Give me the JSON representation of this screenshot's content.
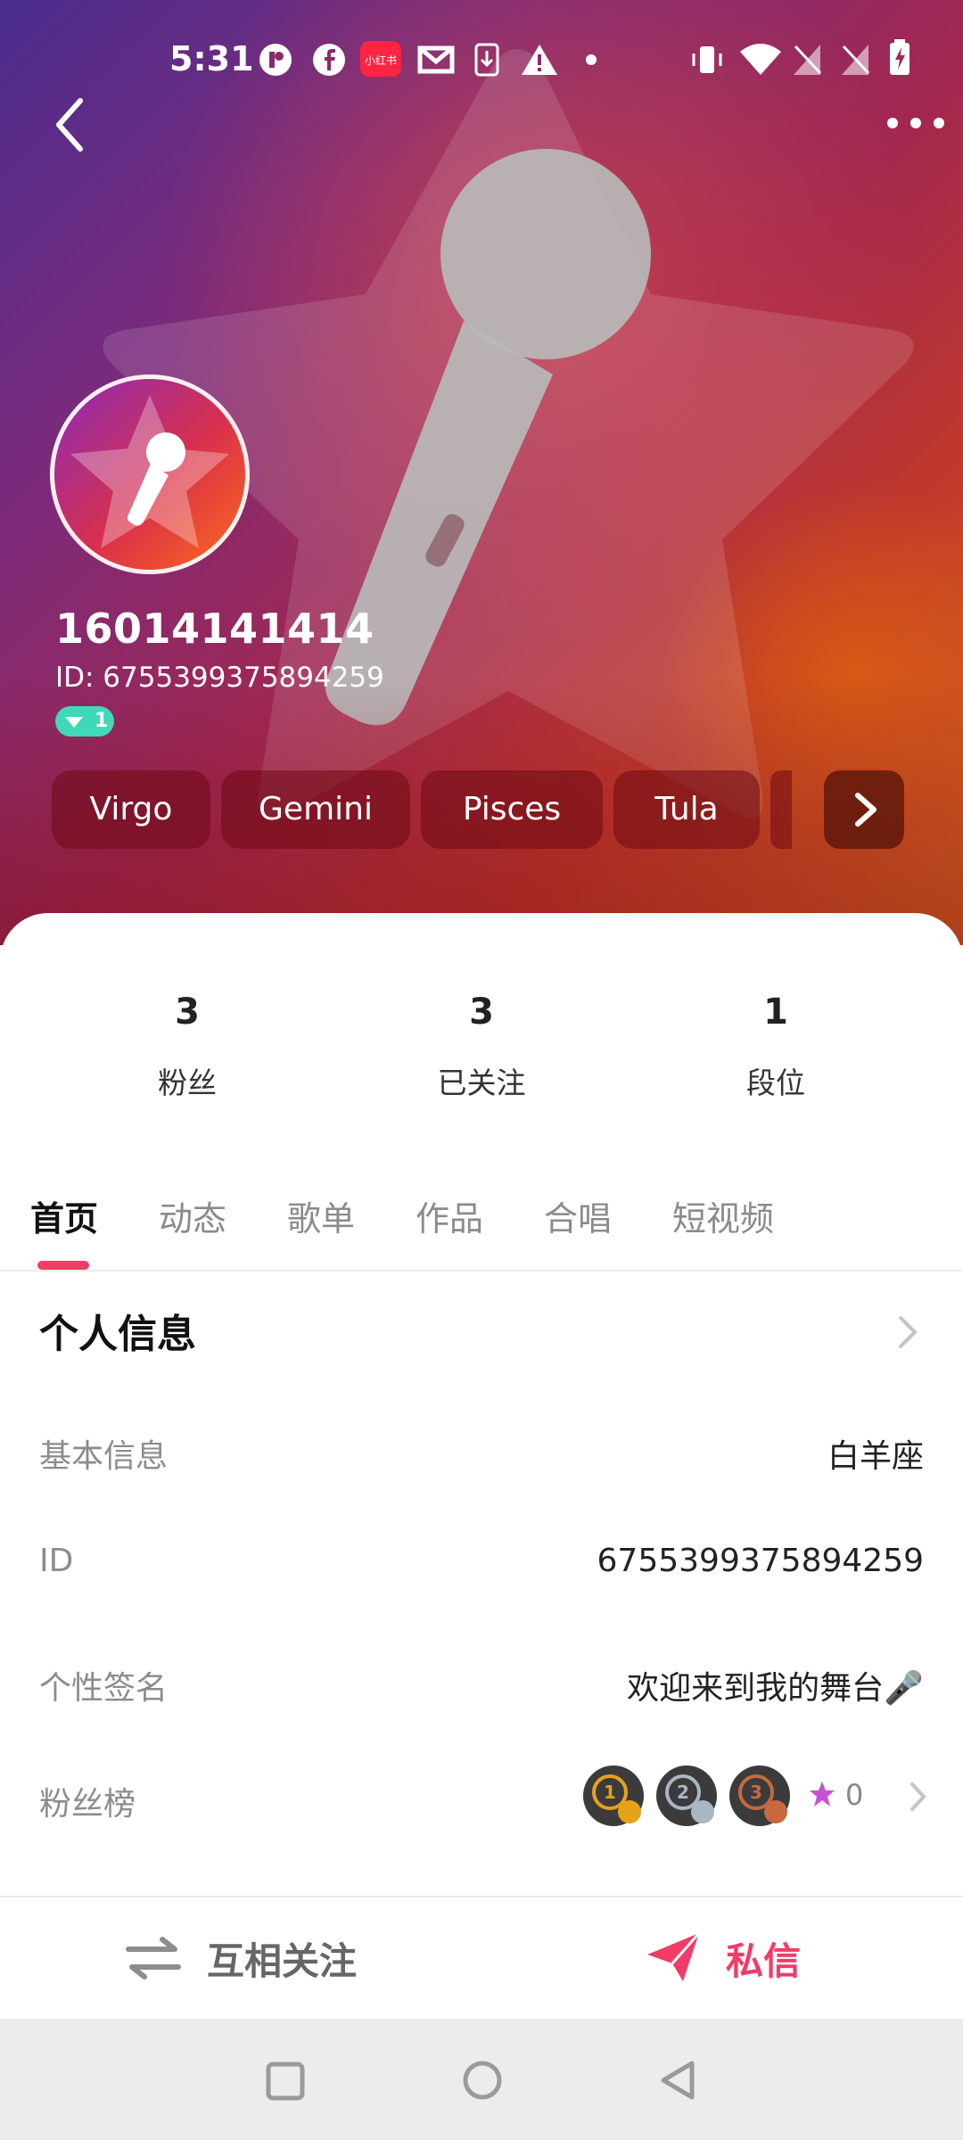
{
  "status_bar": {
    "time": "5:31",
    "icons": [
      "p-icon",
      "facebook-icon",
      "xiaohongshu-icon",
      "gmail-icon",
      "download-icon",
      "warning-icon",
      "dot-icon",
      "vibrate-icon",
      "wifi-icon",
      "no-sim-icon",
      "no-sim-icon",
      "battery-charging-icon"
    ],
    "xiaohongshu_label": "小红书"
  },
  "header": {
    "back_icon": "back-arrow-icon",
    "more_icon": "more-dots-icon"
  },
  "profile": {
    "username": "16014141414",
    "id_line": "ID: 6755399375894259",
    "level": "1",
    "tags": [
      "Virgo",
      "Gemini",
      "Pisces",
      "Tula"
    ],
    "tags_more_icon": "chevron-right-icon"
  },
  "stats": [
    {
      "value": "3",
      "label": "粉丝"
    },
    {
      "value": "3",
      "label": "已关注"
    },
    {
      "value": "1",
      "label": "段位"
    }
  ],
  "tabs": [
    {
      "label": "首页",
      "active": true
    },
    {
      "label": "动态",
      "active": false
    },
    {
      "label": "歌单",
      "active": false
    },
    {
      "label": "作品",
      "active": false
    },
    {
      "label": "合唱",
      "active": false
    },
    {
      "label": "短视频",
      "active": false
    }
  ],
  "info": {
    "title": "个人信息",
    "rows": [
      {
        "label": "基本信息",
        "value": "白羊座"
      },
      {
        "label": "ID",
        "value": "6755399375894259"
      },
      {
        "label": "个性签名",
        "value": "欢迎来到我的舞台🎤"
      },
      {
        "label": "粉丝榜",
        "value": ""
      }
    ],
    "fan_rank_medals": [
      "1",
      "2",
      "3"
    ],
    "fan_rank_star_count": "0"
  },
  "actions": {
    "follow_back": "互相关注",
    "message": "私信"
  },
  "colors": {
    "accent": "#f03c67",
    "level_badge": "#3fd8b9",
    "medal_gold": "#e6a21a",
    "medal_silver": "#a9b6c4",
    "medal_bronze": "#c7683e",
    "star": "#c94fd6"
  },
  "nav": [
    "square-icon",
    "circle-icon",
    "back-triangle-icon"
  ]
}
